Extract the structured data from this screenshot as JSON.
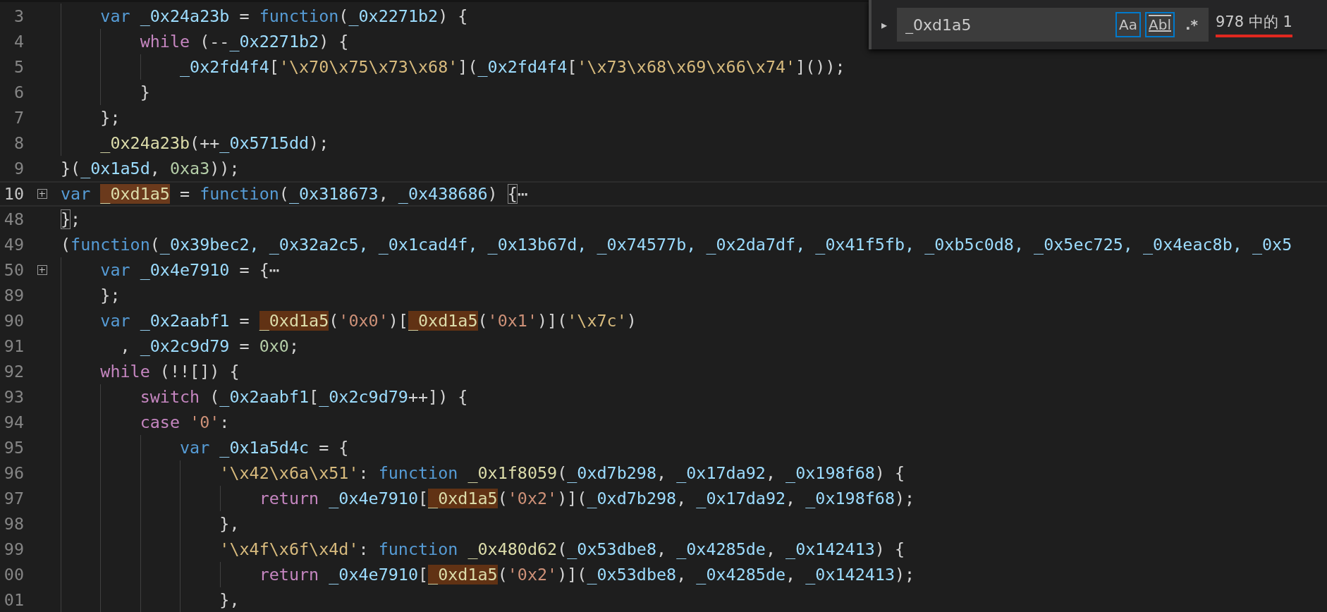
{
  "editor": {
    "lines": [
      {
        "number": "3",
        "tokens": [
          {
            "kind": "keyword",
            "text": "    var "
          },
          {
            "kind": "variable",
            "text": "_0x24a23b"
          },
          {
            "kind": "punct",
            "text": " = "
          },
          {
            "kind": "keyword",
            "text": "function"
          },
          {
            "kind": "punct",
            "text": "("
          },
          {
            "kind": "variable",
            "text": "_0x2271b2"
          },
          {
            "kind": "punct",
            "text": ") {"
          }
        ]
      },
      {
        "number": "4",
        "tokens": [
          {
            "kind": "control",
            "text": "        while"
          },
          {
            "kind": "punct",
            "text": " (--"
          },
          {
            "kind": "variable",
            "text": "_0x2271b2"
          },
          {
            "kind": "punct",
            "text": ") {"
          }
        ]
      },
      {
        "number": "5",
        "tokens": [
          {
            "kind": "variable",
            "text": "            _0x2fd4f4"
          },
          {
            "kind": "punct",
            "text": "["
          },
          {
            "kind": "escape",
            "text": "'\\x70\\x75\\x73\\x68'"
          },
          {
            "kind": "punct",
            "text": "]("
          },
          {
            "kind": "variable",
            "text": "_0x2fd4f4"
          },
          {
            "kind": "punct",
            "text": "["
          },
          {
            "kind": "escape",
            "text": "'\\x73\\x68\\x69\\x66\\x74'"
          },
          {
            "kind": "punct",
            "text": "]());"
          }
        ]
      },
      {
        "number": "6",
        "tokens": [
          {
            "kind": "punct",
            "text": "        }"
          }
        ]
      },
      {
        "number": "7",
        "tokens": [
          {
            "kind": "punct",
            "text": "    };"
          }
        ]
      },
      {
        "number": "8",
        "tokens": [
          {
            "kind": "function",
            "text": "    _0x24a23b"
          },
          {
            "kind": "punct",
            "text": "(++"
          },
          {
            "kind": "variable",
            "text": "_0x5715dd"
          },
          {
            "kind": "punct",
            "text": ");"
          }
        ]
      },
      {
        "number": "9",
        "tokens": [
          {
            "kind": "punct",
            "text": "}("
          },
          {
            "kind": "variable",
            "text": "_0x1a5d"
          },
          {
            "kind": "punct",
            "text": ", "
          },
          {
            "kind": "number",
            "text": "0xa3"
          },
          {
            "kind": "punct",
            "text": "));"
          }
        ]
      },
      {
        "number": "10",
        "current": true,
        "collapsed": true,
        "tokens": [
          {
            "kind": "keyword",
            "text": "var "
          },
          {
            "kind": "current-match",
            "text": "_0xd1a5"
          },
          {
            "kind": "punct",
            "text": " = "
          },
          {
            "kind": "keyword",
            "text": "function"
          },
          {
            "kind": "punct",
            "text": "("
          },
          {
            "kind": "variable",
            "text": "_0x318673"
          },
          {
            "kind": "punct",
            "text": ", "
          },
          {
            "kind": "variable",
            "text": "_0x438686"
          },
          {
            "kind": "punct",
            "text": ") "
          },
          {
            "kind": "bracket",
            "text": "{"
          },
          {
            "kind": "punct",
            "text": "⋯"
          }
        ]
      },
      {
        "number": "48",
        "tokens": [
          {
            "kind": "bracket",
            "text": "}"
          },
          {
            "kind": "punct",
            "text": ";"
          }
        ]
      },
      {
        "number": "49",
        "tokens": [
          {
            "kind": "punct",
            "text": "("
          },
          {
            "kind": "keyword",
            "text": "function"
          },
          {
            "kind": "punct",
            "text": "("
          },
          {
            "kind": "variable",
            "text": "_0x39bec2, _0x32a2c5, _0x1cad4f, _0x13b67d, _0x74577b, _0x2da7df, _0x41f5fb, _0xb5c0d8, _0x5ec725, _0x4eac8b, _0x5"
          }
        ]
      },
      {
        "number": "50",
        "collapsed": true,
        "tokens": [
          {
            "kind": "keyword",
            "text": "    var "
          },
          {
            "kind": "variable",
            "text": "_0x4e7910"
          },
          {
            "kind": "punct",
            "text": " = {⋯"
          }
        ]
      },
      {
        "number": "89",
        "tokens": [
          {
            "kind": "punct",
            "text": "    };"
          }
        ]
      },
      {
        "number": "90",
        "tokens": [
          {
            "kind": "keyword",
            "text": "    var "
          },
          {
            "kind": "variable",
            "text": "_0x2aabf1"
          },
          {
            "kind": "punct",
            "text": " = "
          },
          {
            "kind": "match",
            "text": "_0xd1a5"
          },
          {
            "kind": "punct",
            "text": "("
          },
          {
            "kind": "string",
            "text": "'0x0'"
          },
          {
            "kind": "punct",
            "text": ")["
          },
          {
            "kind": "match",
            "text": "_0xd1a5"
          },
          {
            "kind": "punct",
            "text": "("
          },
          {
            "kind": "string",
            "text": "'0x1'"
          },
          {
            "kind": "punct",
            "text": ")]("
          },
          {
            "kind": "escape",
            "text": "'\\x7c'"
          },
          {
            "kind": "punct",
            "text": ")"
          }
        ]
      },
      {
        "number": "91",
        "tokens": [
          {
            "kind": "punct",
            "text": "      , "
          },
          {
            "kind": "variable",
            "text": "_0x2c9d79"
          },
          {
            "kind": "punct",
            "text": " = "
          },
          {
            "kind": "number",
            "text": "0x0"
          },
          {
            "kind": "punct",
            "text": ";"
          }
        ]
      },
      {
        "number": "92",
        "tokens": [
          {
            "kind": "control",
            "text": "    while"
          },
          {
            "kind": "punct",
            "text": " (!![]) {"
          }
        ]
      },
      {
        "number": "93",
        "tokens": [
          {
            "kind": "control",
            "text": "        switch"
          },
          {
            "kind": "punct",
            "text": " ("
          },
          {
            "kind": "variable",
            "text": "_0x2aabf1"
          },
          {
            "kind": "punct",
            "text": "["
          },
          {
            "kind": "variable",
            "text": "_0x2c9d79"
          },
          {
            "kind": "punct",
            "text": "++]) {"
          }
        ]
      },
      {
        "number": "94",
        "tokens": [
          {
            "kind": "control",
            "text": "        case"
          },
          {
            "kind": "string",
            "text": " '0'"
          },
          {
            "kind": "punct",
            "text": ":"
          }
        ]
      },
      {
        "number": "95",
        "tokens": [
          {
            "kind": "keyword",
            "text": "            var "
          },
          {
            "kind": "variable",
            "text": "_0x1a5d4c"
          },
          {
            "kind": "punct",
            "text": " = {"
          }
        ]
      },
      {
        "number": "96",
        "tokens": [
          {
            "kind": "escape",
            "text": "                '\\x42\\x6a\\x51'"
          },
          {
            "kind": "punct",
            "text": ": "
          },
          {
            "kind": "keyword",
            "text": "function "
          },
          {
            "kind": "function",
            "text": "_0x1f8059"
          },
          {
            "kind": "punct",
            "text": "("
          },
          {
            "kind": "variable",
            "text": "_0xd7b298"
          },
          {
            "kind": "punct",
            "text": ", "
          },
          {
            "kind": "variable",
            "text": "_0x17da92"
          },
          {
            "kind": "punct",
            "text": ", "
          },
          {
            "kind": "variable",
            "text": "_0x198f68"
          },
          {
            "kind": "punct",
            "text": ") {"
          }
        ]
      },
      {
        "number": "97",
        "tokens": [
          {
            "kind": "control",
            "text": "                    return "
          },
          {
            "kind": "variable",
            "text": "_0x4e7910"
          },
          {
            "kind": "punct",
            "text": "["
          },
          {
            "kind": "match",
            "text": "_0xd1a5"
          },
          {
            "kind": "punct",
            "text": "("
          },
          {
            "kind": "string",
            "text": "'0x2'"
          },
          {
            "kind": "punct",
            "text": ")]("
          },
          {
            "kind": "variable",
            "text": "_0xd7b298"
          },
          {
            "kind": "punct",
            "text": ", "
          },
          {
            "kind": "variable",
            "text": "_0x17da92"
          },
          {
            "kind": "punct",
            "text": ", "
          },
          {
            "kind": "variable",
            "text": "_0x198f68"
          },
          {
            "kind": "punct",
            "text": ");"
          }
        ]
      },
      {
        "number": "98",
        "tokens": [
          {
            "kind": "punct",
            "text": "                },"
          }
        ]
      },
      {
        "number": "99",
        "tokens": [
          {
            "kind": "escape",
            "text": "                '\\x4f\\x6f\\x4d'"
          },
          {
            "kind": "punct",
            "text": ": "
          },
          {
            "kind": "keyword",
            "text": "function "
          },
          {
            "kind": "function",
            "text": "_0x480d62"
          },
          {
            "kind": "punct",
            "text": "("
          },
          {
            "kind": "variable",
            "text": "_0x53dbe8"
          },
          {
            "kind": "punct",
            "text": ", "
          },
          {
            "kind": "variable",
            "text": "_0x4285de"
          },
          {
            "kind": "punct",
            "text": ", "
          },
          {
            "kind": "variable",
            "text": "_0x142413"
          },
          {
            "kind": "punct",
            "text": ") {"
          }
        ]
      },
      {
        "number": "00",
        "tokens": [
          {
            "kind": "control",
            "text": "                    return "
          },
          {
            "kind": "variable",
            "text": "_0x4e7910"
          },
          {
            "kind": "punct",
            "text": "["
          },
          {
            "kind": "match",
            "text": "_0xd1a5"
          },
          {
            "kind": "punct",
            "text": "("
          },
          {
            "kind": "string",
            "text": "'0x2'"
          },
          {
            "kind": "punct",
            "text": ")]("
          },
          {
            "kind": "variable",
            "text": "_0x53dbe8"
          },
          {
            "kind": "punct",
            "text": ", "
          },
          {
            "kind": "variable",
            "text": "_0x4285de"
          },
          {
            "kind": "punct",
            "text": ", "
          },
          {
            "kind": "variable",
            "text": "_0x142413"
          },
          {
            "kind": "punct",
            "text": ");"
          }
        ]
      },
      {
        "number": "01",
        "tokens": [
          {
            "kind": "punct",
            "text": "                },"
          }
        ]
      }
    ]
  },
  "find_widget": {
    "toggle": "▸",
    "value": "_0xd1a5",
    "options": [
      {
        "label": "Aa",
        "kind": "case",
        "on": true
      },
      {
        "label": "Abl",
        "kind": "word",
        "on": true
      },
      {
        "label": ".*",
        "kind": "regex",
        "on": false
      }
    ],
    "result": "978 中的 1",
    "result_underlined": true
  }
}
